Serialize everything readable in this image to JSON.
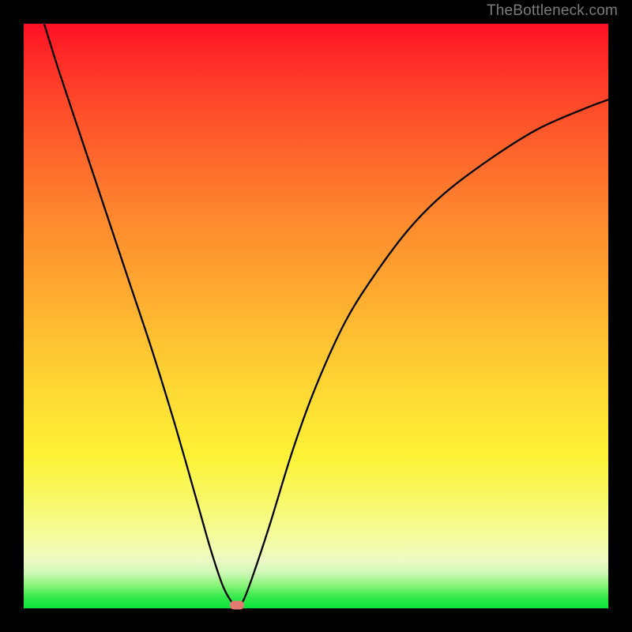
{
  "watermark": "TheBottleneck.com",
  "chart_data": {
    "type": "line",
    "title": "",
    "xlabel": "",
    "ylabel": "",
    "xlim": [
      0,
      1
    ],
    "ylim": [
      0,
      1
    ],
    "series": [
      {
        "name": "bottleneck-curve",
        "x": [
          0.035,
          0.06,
          0.1,
          0.14,
          0.18,
          0.22,
          0.26,
          0.3,
          0.32,
          0.34,
          0.355,
          0.365,
          0.375,
          0.39,
          0.42,
          0.46,
          0.5,
          0.55,
          0.6,
          0.66,
          0.72,
          0.8,
          0.88,
          0.96,
          1.0
        ],
        "y": [
          1.0,
          0.92,
          0.8,
          0.68,
          0.56,
          0.44,
          0.31,
          0.17,
          0.1,
          0.04,
          0.012,
          0.005,
          0.012,
          0.05,
          0.14,
          0.27,
          0.38,
          0.49,
          0.57,
          0.65,
          0.71,
          0.77,
          0.82,
          0.855,
          0.87
        ]
      }
    ],
    "marker": {
      "x": 0.365,
      "y": 0.005
    },
    "background_gradient_stops": [
      {
        "pos": 0.0,
        "color": "#fe1026"
      },
      {
        "pos": 0.4,
        "color": "#fe9e2f"
      },
      {
        "pos": 0.72,
        "color": "#fdee35"
      },
      {
        "pos": 0.9,
        "color": "#eefbc0"
      },
      {
        "pos": 1.0,
        "color": "#08e33c"
      }
    ],
    "description": "V-shaped bottleneck curve over a vertical red-to-green gradient. Curve descends steeply from top-left, reaches a minimum near x≈0.365 at the bottom, then rises with a gentler concave shape toward the upper-right."
  }
}
